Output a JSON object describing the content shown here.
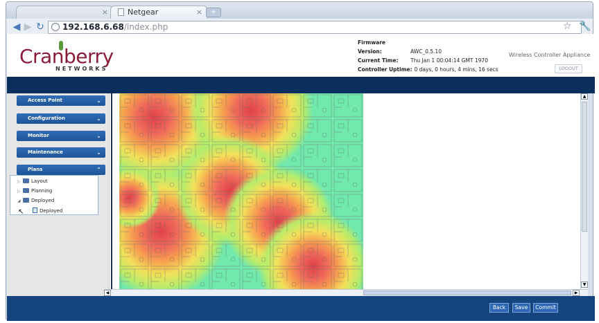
{
  "browser": {
    "tabs": [
      {
        "label": ""
      },
      {
        "label": "Netgear"
      }
    ],
    "url_host": "192.168.6.68",
    "url_path": "/index.php"
  },
  "header": {
    "logo_text": "Cranberry",
    "logo_subtext": "NETWORKS",
    "firmware_label": "Firmware Version:",
    "firmware_value": "AWC_0.5.10",
    "time_label": "Current Time:",
    "time_value": "Thu Jan 1 00:04:14 GMT 1970",
    "uptime_label": "Controller Uptime:",
    "uptime_value": "0 days, 0 hours, 4 mins, 16 secs",
    "appliance_label": "Wireless Controller Appliance",
    "logout_label": "LOGOUT"
  },
  "sidebar": {
    "sections": [
      {
        "label": "Access Point"
      },
      {
        "label": "Configuration"
      },
      {
        "label": "Monitor"
      },
      {
        "label": "Maintenance"
      },
      {
        "label": "Plans"
      }
    ],
    "tree": [
      {
        "label": "Layout"
      },
      {
        "label": "Planning"
      },
      {
        "label": "Deployed"
      },
      {
        "label": "Deployed"
      }
    ]
  },
  "footer": {
    "back_label": "Back",
    "save_label": "Save",
    "commit_label": "Commit"
  },
  "colors": {
    "header_bar": "#0a2f5e",
    "footer": "#16447f",
    "accordion": "#1f5597",
    "logo": "#8a1c3a"
  }
}
